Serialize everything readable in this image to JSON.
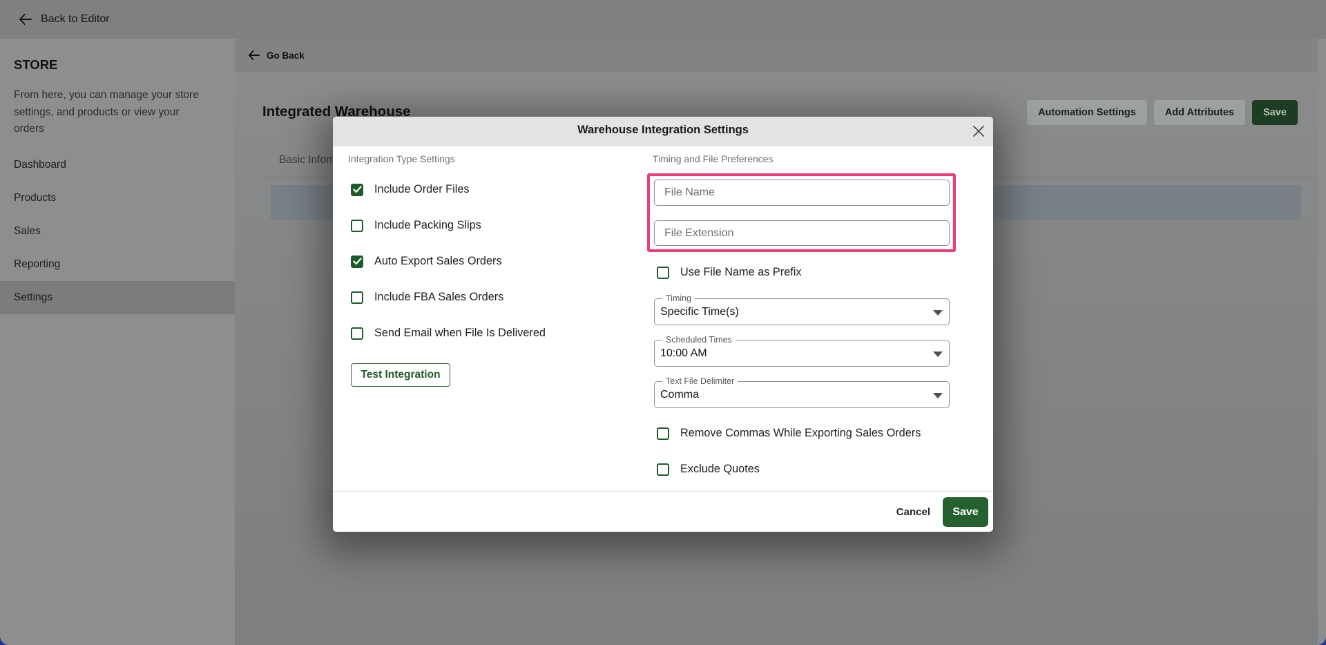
{
  "topbar": {
    "back_label": "Back to Editor"
  },
  "sidebar": {
    "title": "STORE",
    "description": "From here, you can manage your store settings, and products or view your orders",
    "items": [
      {
        "label": "Dashboard",
        "active": false
      },
      {
        "label": "Products",
        "active": false
      },
      {
        "label": "Sales",
        "active": false
      },
      {
        "label": "Reporting",
        "active": false
      },
      {
        "label": "Settings",
        "active": true
      }
    ]
  },
  "main": {
    "goback_label": "Go Back",
    "page_title": "Integrated Warehouse",
    "tab_label": "Basic Information",
    "actions": {
      "automation_settings": "Automation Settings",
      "add_attributes": "Add Attributes",
      "save": "Save"
    }
  },
  "modal": {
    "title": "Warehouse Integration Settings",
    "left_section": {
      "label": "Integration Type Settings",
      "checkboxes": [
        {
          "label": "Include Order Files",
          "checked": true
        },
        {
          "label": "Include Packing Slips",
          "checked": false
        },
        {
          "label": "Auto Export Sales Orders",
          "checked": true
        },
        {
          "label": "Include FBA Sales Orders",
          "checked": false
        },
        {
          "label": "Send Email when File Is Delivered",
          "checked": false
        }
      ],
      "test_button": "Test Integration"
    },
    "right_section": {
      "label": "Timing and File Preferences",
      "file_name_placeholder": "File Name",
      "file_extension_placeholder": "File Extension",
      "prefix_checkbox": {
        "label": "Use File Name as Prefix",
        "checked": false
      },
      "selects": [
        {
          "label": "Timing",
          "value": "Specific Time(s)"
        },
        {
          "label": "Scheduled Times",
          "value": "10:00 AM"
        },
        {
          "label": "Text File Delimiter",
          "value": "Comma"
        }
      ],
      "checkboxes": [
        {
          "label": "Remove Commas While Exporting Sales Orders",
          "checked": false
        },
        {
          "label": "Exclude Quotes",
          "checked": false
        }
      ]
    },
    "footer": {
      "cancel": "Cancel",
      "save": "Save"
    }
  },
  "colors": {
    "accent_green": "#1e5b2a",
    "save_green": "#24612f",
    "highlight_pink": "#ee3d76",
    "modal_header_gray": "#e3e3e3",
    "overlay_gray": "#919191",
    "row_highlight_blue_gray": "#788086",
    "backdrop_blue": "#16329d"
  }
}
